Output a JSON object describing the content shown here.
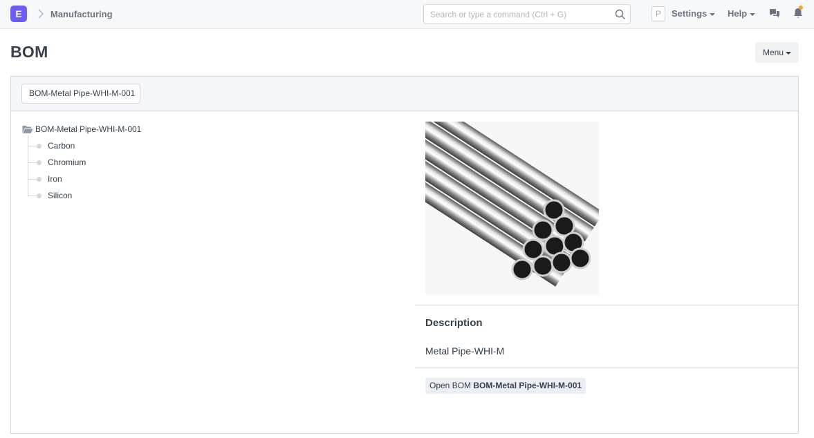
{
  "app": {
    "logo_letter": "E"
  },
  "navbar": {
    "breadcrumb": "Manufacturing",
    "search_placeholder": "Search or type a command (Ctrl + G)",
    "avatar_letter": "P",
    "settings_label": "Settings",
    "help_label": "Help"
  },
  "page": {
    "title": "BOM",
    "menu_label": "Menu"
  },
  "toolbar": {
    "bom_value": "BOM-Metal Pipe-WHI-M-001"
  },
  "tree": {
    "root": "BOM-Metal Pipe-WHI-M-001",
    "children": [
      "Carbon",
      "Chromium",
      "Iron",
      "Silicon"
    ]
  },
  "details": {
    "description_heading": "Description",
    "description_text": "Metal Pipe-WHI-M",
    "open_bom_prefix": "Open BOM",
    "open_bom_name": "BOM-Metal Pipe-WHI-M-001"
  },
  "colors": {
    "brand": "#6d5cf7",
    "notification_dot": "#f8a427"
  }
}
